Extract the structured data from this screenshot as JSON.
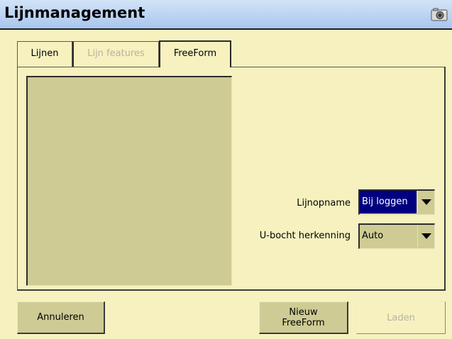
{
  "window": {
    "title": "Lijnmanagement",
    "title_icon": "camera-icon"
  },
  "tabs": [
    {
      "label": "Lijnen",
      "state": "normal"
    },
    {
      "label": "Lijn features",
      "state": "disabled"
    },
    {
      "label": "FreeForm",
      "state": "active"
    }
  ],
  "form": {
    "line_recording": {
      "label": "Lijnopname",
      "value": "Bij loggen"
    },
    "u_turn_detection": {
      "label": "U-bocht herkenning",
      "value": "Auto"
    }
  },
  "buttons": {
    "cancel": "Annuleren",
    "new_freeform_line1": "Nieuw",
    "new_freeform_line2": "FreeForm",
    "load": "Laden"
  },
  "colors": {
    "background": "#f6f1bf",
    "titlebar": "#a9c6ee",
    "control": "#cecb94",
    "selection": "#000080"
  }
}
